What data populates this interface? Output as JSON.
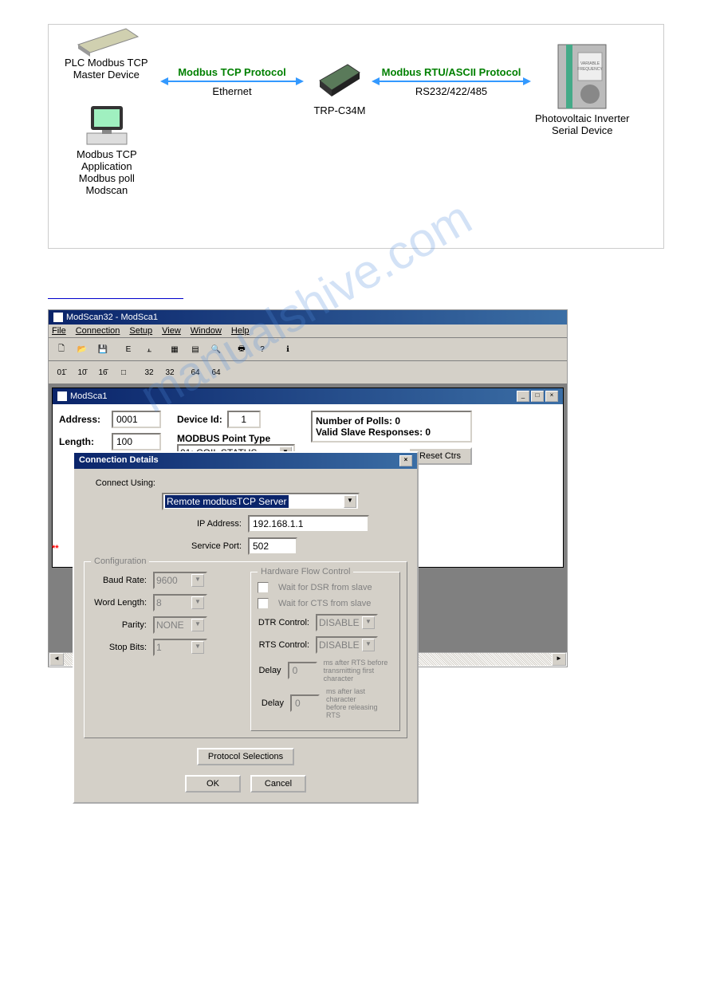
{
  "diagram": {
    "plc_label": "PLC Modbus TCP\nMaster Device",
    "pc_label": "Modbus TCP\nApplication\nModbus poll\nModscan",
    "arrow1_top": "Modbus TCP Protocol",
    "arrow1_bot": "Ethernet",
    "gateway_label": "TRP-C34M",
    "arrow2_top": "Modbus RTU/ASCII Protocol",
    "arrow2_bot": "RS232/422/485",
    "inverter_label": "Photovoltaic Inverter\nSerial Device",
    "inverter_tag": "VARIABLE\nFREQUENCY"
  },
  "app": {
    "title": "ModScan32 - ModSca1",
    "menus": [
      "File",
      "Connection",
      "Setup",
      "View",
      "Window",
      "Help"
    ]
  },
  "subwin": {
    "title": "ModSca1",
    "address_lbl": "Address:",
    "address_val": "0001",
    "length_lbl": "Length:",
    "length_val": "100",
    "devid_lbl": "Device Id:",
    "devid_val": "1",
    "ptype_lbl": "MODBUS Point Type",
    "ptype_val": "01: COIL STATUS",
    "polls": "Number of Polls: 0",
    "resp": "Valid Slave Responses: 0",
    "reset": "Reset Ctrs",
    "err": "**"
  },
  "dialog": {
    "title": "Connection Details",
    "connect_lbl": "Connect Using:",
    "connect_val": "Remote modbusTCP Server",
    "ip_lbl": "IP Address:",
    "ip_val": "192.168.1.1",
    "port_lbl": "Service Port:",
    "port_val": "502",
    "cfg_title": "Configuration",
    "baud_lbl": "Baud Rate:",
    "baud_val": "9600",
    "word_lbl": "Word Length:",
    "word_val": "8",
    "parity_lbl": "Parity:",
    "parity_val": "NONE",
    "stop_lbl": "Stop Bits:",
    "stop_val": "1",
    "hw_title": "Hardware Flow Control",
    "dsr": "Wait for DSR from slave",
    "cts": "Wait for CTS from slave",
    "dtr_lbl": "DTR Control:",
    "dtr_val": "DISABLE",
    "rts_lbl": "RTS Control:",
    "rts_val": "DISABLE",
    "d1_lbl": "Delay",
    "d1_val": "0",
    "d1_txt": "ms after RTS before\ntransmitting first character",
    "d2_lbl": "Delay",
    "d2_val": "0",
    "d2_txt": "ms after last character\nbefore releasing RTS",
    "proto": "Protocol Selections",
    "ok": "OK",
    "cancel": "Cancel"
  },
  "watermark": "manualshive.com"
}
